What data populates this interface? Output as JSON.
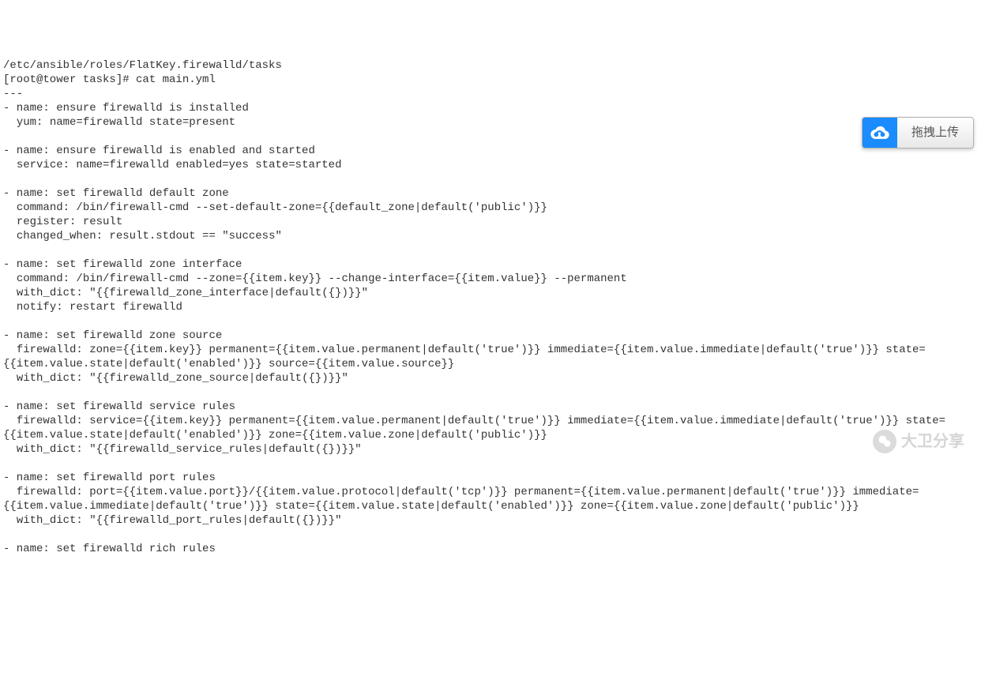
{
  "terminal": {
    "path_line": "/etc/ansible/roles/FlatKey.firewalld/tasks",
    "prompt_line": "[root@tower tasks]# cat main.yml",
    "yaml_content": "---\n- name: ensure firewalld is installed\n  yum: name=firewalld state=present\n\n- name: ensure firewalld is enabled and started\n  service: name=firewalld enabled=yes state=started\n\n- name: set firewalld default zone\n  command: /bin/firewall-cmd --set-default-zone={{default_zone|default('public')}}\n  register: result\n  changed_when: result.stdout == \"success\"\n\n- name: set firewalld zone interface\n  command: /bin/firewall-cmd --zone={{item.key}} --change-interface={{item.value}} --permanent\n  with_dict: \"{{firewalld_zone_interface|default({})}}\"\n  notify: restart firewalld\n\n- name: set firewalld zone source\n  firewalld: zone={{item.key}} permanent={{item.value.permanent|default('true')}} immediate={{item.value.immediate|default('true')}} state={{item.value.state|default('enabled')}} source={{item.value.source}}\n  with_dict: \"{{firewalld_zone_source|default({})}}\"\n\n- name: set firewalld service rules\n  firewalld: service={{item.key}} permanent={{item.value.permanent|default('true')}} immediate={{item.value.immediate|default('true')}} state={{item.value.state|default('enabled')}} zone={{item.value.zone|default('public')}}\n  with_dict: \"{{firewalld_service_rules|default({})}}\"\n\n- name: set firewalld port rules\n  firewalld: port={{item.value.port}}/{{item.value.protocol|default('tcp')}} permanent={{item.value.permanent|default('true')}} immediate={{item.value.immediate|default('true')}} state={{item.value.state|default('enabled')}} zone={{item.value.zone|default('public')}}\n  with_dict: \"{{firewalld_port_rules|default({})}}\"\n\n- name: set firewalld rich rules"
  },
  "upload_widget": {
    "label": "拖拽上传"
  },
  "watermark": {
    "text": "大卫分享"
  }
}
